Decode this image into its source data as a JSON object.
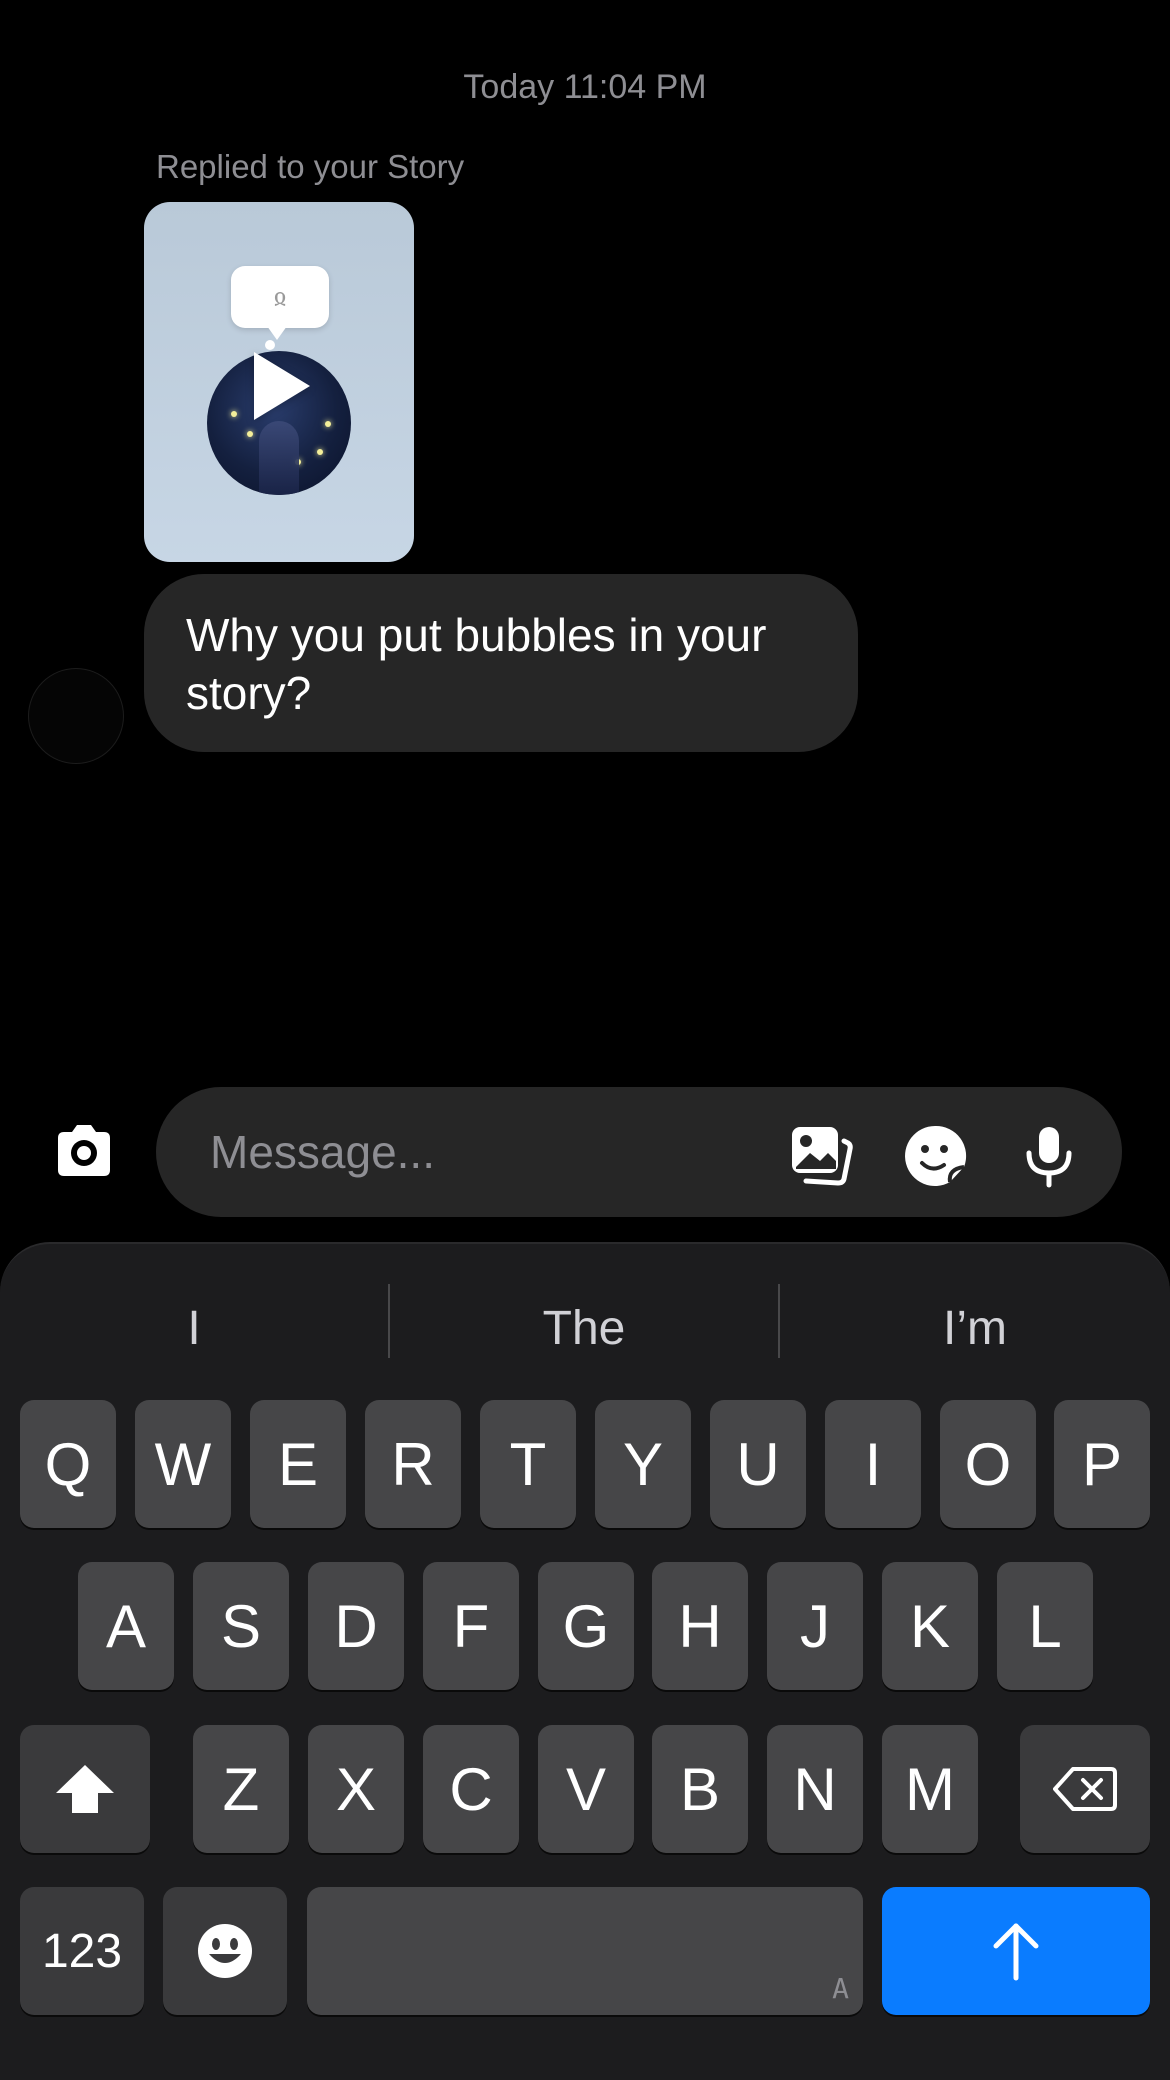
{
  "chat": {
    "timestamp": "Today 11:04 PM",
    "reply_label": "Replied to your Story",
    "story_bubble_symbol": "ჲ",
    "message_text": "Why you put bubbles in your story?"
  },
  "composer": {
    "placeholder": "Message...",
    "icons": [
      "camera-icon",
      "gallery-icon",
      "sticker-icon",
      "microphone-icon"
    ]
  },
  "keyboard": {
    "suggestions": [
      "I",
      "The",
      "I’m"
    ],
    "row1": [
      "Q",
      "W",
      "E",
      "R",
      "T",
      "Y",
      "U",
      "I",
      "O",
      "P"
    ],
    "row2": [
      "A",
      "S",
      "D",
      "F",
      "G",
      "H",
      "J",
      "K",
      "L"
    ],
    "row3": [
      "Z",
      "X",
      "C",
      "V",
      "B",
      "N",
      "M"
    ],
    "numbers_label": "123",
    "space_hint": "A",
    "send_color": "#0a7cff"
  }
}
